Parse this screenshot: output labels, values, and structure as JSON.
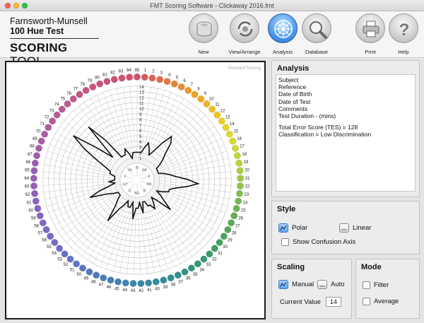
{
  "window": {
    "title": "FMT Scoring Software - Clickaway 2016.fmt"
  },
  "brand": {
    "line1": "Farnsworth-Munsell",
    "line2": "100 Hue Test",
    "scoring": "SCORING",
    "tool": "TOOL"
  },
  "toolbar": {
    "new_label": "New",
    "view_label": "View/Arrange",
    "analysis_label": "Analysis",
    "database_label": "Database",
    "print_label": "Print",
    "help_label": "Help"
  },
  "chart": {
    "watermark": "Standard Scoring",
    "scale_labels": [
      "1",
      "2",
      "3",
      "4",
      "5",
      "6",
      "7",
      "8",
      "9",
      "10",
      "11",
      "12",
      "13",
      "14"
    ],
    "letter_labels": [
      "R",
      "RP",
      "P",
      "PB",
      "B",
      "BG",
      "G",
      "GY",
      "Y",
      "YR"
    ],
    "cap_numbers": [
      "85",
      "1",
      "2",
      "3",
      "4",
      "5",
      "6",
      "7",
      "8",
      "9",
      "10",
      "11",
      "12",
      "13",
      "14",
      "15",
      "16",
      "17",
      "18",
      "19",
      "20",
      "21",
      "22",
      "23",
      "24",
      "25",
      "26",
      "27",
      "28",
      "29",
      "30",
      "31",
      "32",
      "33",
      "34",
      "35",
      "36",
      "37",
      "38",
      "39",
      "40",
      "41",
      "42",
      "43",
      "44",
      "45",
      "46",
      "47",
      "48",
      "49",
      "50",
      "51",
      "52",
      "53",
      "54",
      "55",
      "56",
      "57",
      "58",
      "59",
      "60",
      "61",
      "62",
      "63",
      "64",
      "65",
      "66",
      "67",
      "68",
      "69",
      "70",
      "71",
      "72",
      "73",
      "74",
      "75",
      "76",
      "77",
      "78",
      "79",
      "80",
      "81",
      "82",
      "83",
      "84"
    ],
    "cap_colors": [
      "#d2506c",
      "#d65a5a",
      "#dd6450",
      "#e26e45",
      "#e57a3c",
      "#e88434",
      "#ea8e2e",
      "#ec9828",
      "#eda224",
      "#eeab22",
      "#efb420",
      "#efbd1f",
      "#eec520",
      "#ecce22",
      "#e8d526",
      "#e2d92a",
      "#dada2e",
      "#d0d932",
      "#c4d636",
      "#b8d23a",
      "#aacd3e",
      "#9dc842",
      "#90c346",
      "#84be4a",
      "#78b94e",
      "#6db451",
      "#63b054",
      "#5aac57",
      "#52a85a",
      "#4ba45d",
      "#44a160",
      "#3f9e65",
      "#3a9b6b",
      "#369971",
      "#339777",
      "#31957e",
      "#309385",
      "#30918b",
      "#308f92",
      "#318d98",
      "#338b9e",
      "#3589a4",
      "#3887a9",
      "#3b85ae",
      "#3f83b3",
      "#4381b7",
      "#477fba",
      "#4b7dbd",
      "#4f7bbf",
      "#5479c1",
      "#5977c3",
      "#5e75c4",
      "#6373c5",
      "#6871c6",
      "#6d6fc6",
      "#726dc6",
      "#776bc5",
      "#7c69c4",
      "#8167c3",
      "#8665c2",
      "#8a63c0",
      "#8e61be",
      "#9260bc",
      "#965fba",
      "#9a5eb7",
      "#9d5db4",
      "#a05cb1",
      "#a35cae",
      "#a65caa",
      "#a95ca6",
      "#ac5ca2",
      "#af5c9e",
      "#b25c9a",
      "#b55c96",
      "#b85b92",
      "#bb5a8e",
      "#be598a",
      "#c15886",
      "#c45782",
      "#c7567e",
      "#c9557a",
      "#cb5476",
      "#cd5372",
      "#cf526e",
      "#d1516c"
    ],
    "error_scores": [
      4,
      4,
      4,
      5,
      6,
      5,
      4,
      5,
      7,
      9,
      8,
      6,
      5,
      4,
      3,
      3,
      3,
      3,
      4,
      5,
      6,
      8,
      10,
      8,
      6,
      5,
      5,
      4,
      3,
      4,
      5,
      7,
      4,
      3,
      4,
      5,
      4,
      4,
      3,
      3,
      5,
      3,
      4,
      4,
      6,
      3,
      4,
      4,
      3,
      4,
      5,
      8,
      5,
      4,
      3,
      3,
      3,
      4,
      5,
      8,
      6,
      4,
      3,
      4,
      3,
      3,
      3,
      4,
      4,
      5,
      7,
      10,
      13,
      8,
      5,
      12,
      8,
      4,
      4,
      4,
      5,
      4,
      3,
      4,
      4
    ]
  },
  "analysis": {
    "title": "Analysis",
    "subject": "Subject",
    "reference": "Reference",
    "dob": "Date of Birth",
    "dot": "Date of Test",
    "comments": "Comments",
    "duration": "Test Duration - (mins)",
    "tes": "Total Error Score (TES) = 128",
    "classification": "Classification = Low Discrimination"
  },
  "style": {
    "title": "Style",
    "polar": "Polar",
    "linear": "Linear",
    "confusion": "Show Confusion Axis"
  },
  "scaling": {
    "title": "Scaling",
    "manual": "Manual",
    "auto": "Auto",
    "current_label": "Current Value",
    "current_value": "14"
  },
  "mode": {
    "title": "Mode",
    "filter": "Filter",
    "average": "Average"
  }
}
